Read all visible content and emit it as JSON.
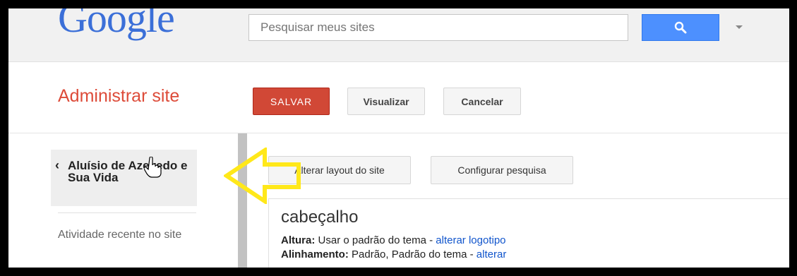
{
  "topbar": {
    "logo_text": "Google",
    "search_placeholder": "Pesquisar meus sites",
    "search_button_icon": "search-icon",
    "account_dropdown_icon": "caret-down-icon"
  },
  "header": {
    "title": "Administrar site",
    "buttons": {
      "save": "SALVAR",
      "preview": "Visualizar",
      "cancel": "Cancelar"
    }
  },
  "sidebar": {
    "current_site": "Aluísio de Azevedo e Sua Vida",
    "items": [
      {
        "label": "Atividade recente no site"
      }
    ]
  },
  "content": {
    "buttons": {
      "change_layout": "Alterar layout do site",
      "configure_search": "Configurar pesquisa"
    },
    "header_panel": {
      "title": "cabeçalho",
      "height_label": "Altura:",
      "height_value": "Usar o padrão do tema - ",
      "height_link": "alterar logotipo",
      "align_label": "Alinhamento:",
      "align_value": "Padrão, Padrão do tema - ",
      "align_link": "alterar"
    }
  },
  "colors": {
    "accent_red": "#dd4b39",
    "save_button": "#d14836",
    "search_blue": "#4d90fe",
    "link_blue": "#1155cc",
    "annotation_arrow": "#ffe81a"
  }
}
